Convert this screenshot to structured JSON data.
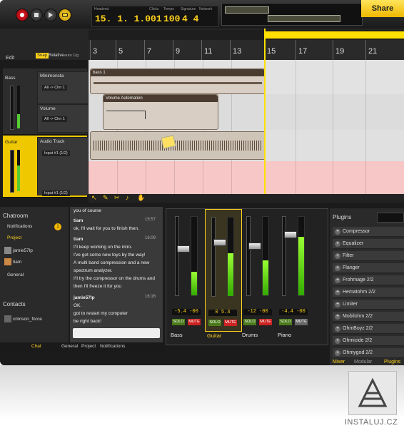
{
  "share_label": "Share",
  "transport": {
    "headers": [
      "Headend",
      "Clicks",
      "Tempo",
      "Signature",
      "Network"
    ],
    "position": "15. 1. 1.001",
    "tempo": "100",
    "signature": "4 4"
  },
  "edit": {
    "label": "Edit",
    "snap": "Snap",
    "relative": "Relative",
    "grid": "auto 1/g"
  },
  "ruler": [
    "3",
    "5",
    "7",
    "9",
    "11",
    "13",
    "15",
    "17",
    "19",
    "21"
  ],
  "tracks": [
    {
      "name": "Bass",
      "sub": "Minimonsta",
      "ch": "All -> Chn 1",
      "sub2": "Volume",
      "ch2": "All -> Chn 1"
    },
    {
      "name": "Guitar",
      "sub": "Audio Track",
      "ch": "Input #1 (1/2)",
      "ch2": "Input #1 (1/2)"
    }
  ],
  "clips": {
    "bass": "bass 1",
    "automation": "Volume Automation"
  },
  "chat": {
    "title": "Chatroom",
    "notifications": "Notifications",
    "notif_count": "1",
    "project": "Project",
    "users": [
      "jamie57lp",
      "tiam"
    ],
    "general": "General",
    "contacts": "Contacts",
    "contact_user": "crimson_force"
  },
  "messages": [
    {
      "t": "",
      "text": "you of course"
    },
    {
      "t": "15:57",
      "text": "tiam"
    },
    {
      "t": "",
      "text": "ok, I'll wait for you to finish then."
    },
    {
      "t": "16:09",
      "text": "tiam"
    },
    {
      "t": "",
      "text": "I'll keep working on the intro."
    },
    {
      "t": "",
      "text": "I've got some new toys by the way!"
    },
    {
      "t": "",
      "text": "A multi band compression and a new"
    },
    {
      "t": "",
      "text": "spectrum analyzer."
    },
    {
      "t": "",
      "text": "I'll try the compressor on the drums and"
    },
    {
      "t": "",
      "text": "then I'll freeze it for you"
    },
    {
      "t": "16:16",
      "text": "jamie57lp"
    },
    {
      "t": "",
      "text": "OK."
    },
    {
      "t": "",
      "text": "got to restart my computer"
    },
    {
      "t": "",
      "text": "be right back!"
    }
  ],
  "mixer": [
    {
      "name": "Bass",
      "pan": [
        "-5.4",
        "-00"
      ],
      "solo": "SOLO",
      "mute": "MUTE",
      "mute_on": true,
      "level": 0.3
    },
    {
      "name": "Guitar",
      "pan": [
        "0",
        "5.4"
      ],
      "solo": "SOLO",
      "mute": "MUTE",
      "mute_on": true,
      "level": 0.55
    },
    {
      "name": "Drums",
      "pan": [
        "-12",
        "-00"
      ],
      "solo": "SOLO",
      "mute": "MUTE",
      "mute_on": true,
      "level": 0.45
    },
    {
      "name": "Piano",
      "pan": [
        "-4.4",
        "-00"
      ],
      "solo": "SOLO",
      "mute": "MUTE",
      "mute_on": false,
      "level": 0.75
    }
  ],
  "plugins": {
    "title": "Plugins",
    "items": [
      "Compressor",
      "Equalizer",
      "Filter",
      "Flanger",
      "Frohmage 2/2",
      "Hematohm 2/2",
      "Limiter",
      "Mobilohm 2/2",
      "OhmBoyz 2/2",
      "Ohmicide 2/2",
      "Ohmygod 2/2"
    ]
  },
  "bottom_tabs": [
    "Chat",
    "General",
    "Project",
    "Notifications"
  ],
  "right_tabs": [
    "Mixer",
    "Modular",
    "Plugins"
  ],
  "watermark": "INSTALUJ.CZ"
}
